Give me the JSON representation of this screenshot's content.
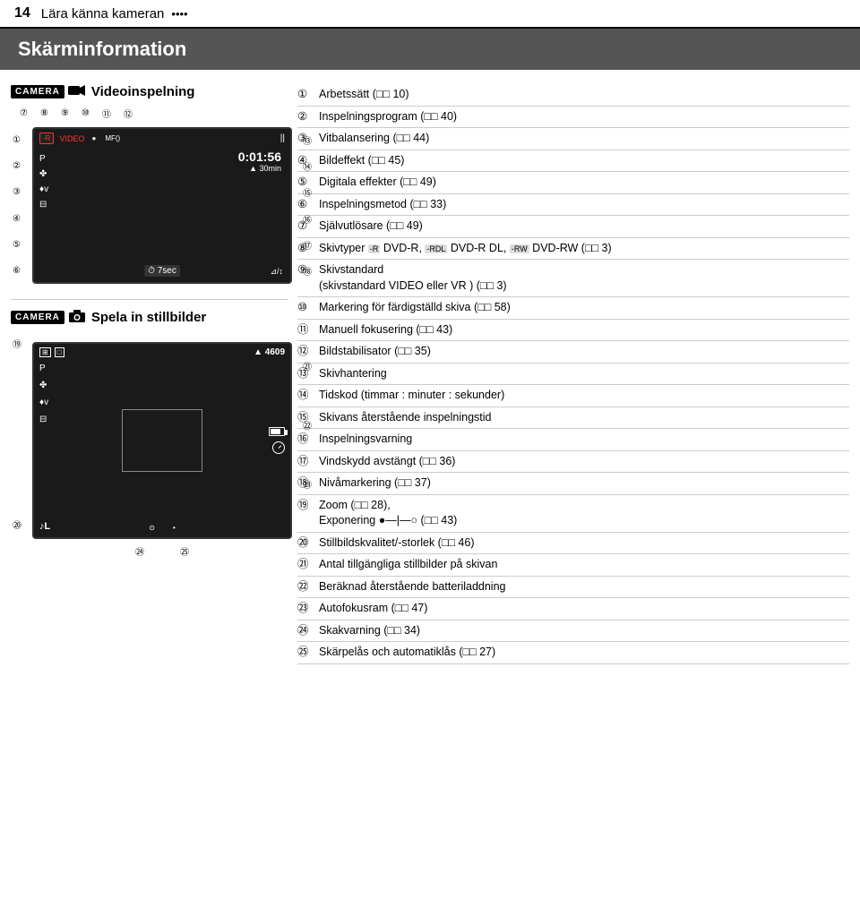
{
  "page": {
    "number": "14",
    "title": "Lära känna kameran",
    "dots": "••••"
  },
  "section": {
    "title": "Skärminformation"
  },
  "video_mode": {
    "camera_label": "CAMERA",
    "mode_label": "Videoinspelning",
    "top_numbers": [
      "⑦",
      "⑧",
      "⑨",
      "⑩",
      "⑪",
      "⑫"
    ],
    "left_numbers": [
      "①",
      "②",
      "③",
      "④",
      "⑤",
      "⑥"
    ],
    "right_numbers": [
      "⑬",
      "⑭",
      "⑮",
      "⑯",
      "⑰",
      "⑱"
    ],
    "screen": {
      "rec": "-R",
      "video": "VIDEO",
      "mf": "MF()",
      "time": "0:01:56",
      "remaining": "30min",
      "timer": "7 sec",
      "pause": "||"
    }
  },
  "still_mode": {
    "camera_label": "CAMERA",
    "mode_label": "Spela in stillbilder",
    "left_numbers": [
      "⑲",
      "⑳"
    ],
    "right_numbers": [
      "㉑",
      "㉒",
      "㉓"
    ],
    "bottom_numbers": [
      "㉔",
      "㉕"
    ],
    "screen": {
      "count": "4609",
      "p": "P"
    }
  },
  "items": [
    {
      "num": "①",
      "text": "Arbetssätt (□□ 10)"
    },
    {
      "num": "②",
      "text": "Inspelningsprogram (□□ 40)"
    },
    {
      "num": "③",
      "text": "Vitbalansering (□□ 44)"
    },
    {
      "num": "④",
      "text": "Bildeffekt (□□ 45)"
    },
    {
      "num": "⑤",
      "text": "Digitala effekter (□□ 49)"
    },
    {
      "num": "⑥",
      "text": "Inspelningsmetod (□□ 33)"
    },
    {
      "num": "⑦",
      "text": "Självutlösare (□□ 49)"
    },
    {
      "num": "⑧",
      "text": "Skivtyper ®️ DVD-R, ®️DL DVD-R DL, ®️RW DVD-RW (□□ 3)"
    },
    {
      "num": "⑨",
      "text": "Skivstandard (skivstandard VIDEO eller VR ) (□□ 3)"
    },
    {
      "num": "⑩",
      "text": "Markering för färdigställd skiva (□□ 58)"
    },
    {
      "num": "⑪",
      "text": "Manuell fokusering (□□ 43)"
    },
    {
      "num": "⑫",
      "text": "Bildstabilisator (□□ 35)"
    },
    {
      "num": "⑬",
      "text": "Skivhantering"
    },
    {
      "num": "⑭",
      "text": "Tidskod (timmar : minuter : sekunder)"
    },
    {
      "num": "⑮",
      "text": "Skivans återstående inspelningstid"
    },
    {
      "num": "⑯",
      "text": "Inspelningsvarning"
    },
    {
      "num": "⑰",
      "text": "Vindskydd avstängt (□□ 36)"
    },
    {
      "num": "⑱",
      "text": "Nivåmarkering (□□ 37)"
    },
    {
      "num": "⑲",
      "text": "Zoom (□□ 28), Exponering ●—|—○ (□□ 43)"
    },
    {
      "num": "⑳",
      "text": "Stillbildskvalitet/-storlek (□□ 46)"
    },
    {
      "num": "㉑",
      "text": "Antal tillgängliga stillbilder på skivan"
    },
    {
      "num": "㉒",
      "text": "Beräknad återstående batteriladdning"
    },
    {
      "num": "㉓",
      "text": "Autofokusram (□□ 47)"
    },
    {
      "num": "㉔",
      "text": "Skakvarning (□□ 34)"
    },
    {
      "num": "㉕",
      "text": "Skärpelås och automatiklås (□□ 27)"
    }
  ]
}
